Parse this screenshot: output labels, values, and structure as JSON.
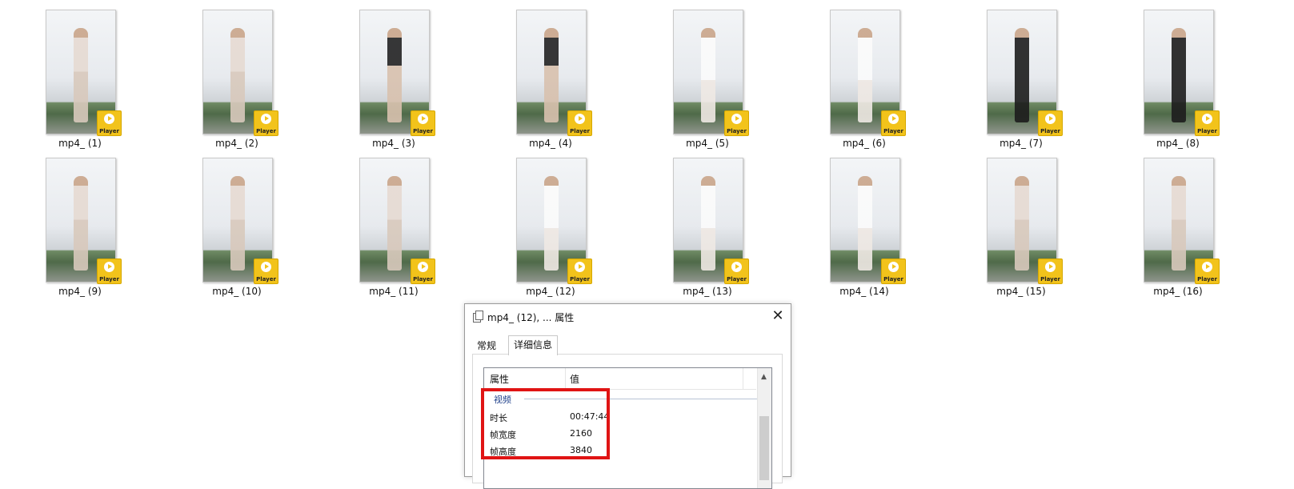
{
  "files": [
    {
      "name": "mp4_ (1)",
      "style": "light"
    },
    {
      "name": "mp4_ (2)",
      "style": "light"
    },
    {
      "name": "mp4_ (3)",
      "style": "mid"
    },
    {
      "name": "mp4_ (4)",
      "style": "mid"
    },
    {
      "name": "mp4_ (5)",
      "style": "white"
    },
    {
      "name": "mp4_ (6)",
      "style": "white"
    },
    {
      "name": "mp4_ (7)",
      "style": "dark"
    },
    {
      "name": "mp4_ (8)",
      "style": "dark"
    },
    {
      "name": "mp4_ (9)",
      "style": "light"
    },
    {
      "name": "mp4_ (10)",
      "style": "light"
    },
    {
      "name": "mp4_ (11)",
      "style": "light"
    },
    {
      "name": "mp4_ (12)",
      "style": "white"
    },
    {
      "name": "mp4_ (13)",
      "style": "white"
    },
    {
      "name": "mp4_ (14)",
      "style": "white"
    },
    {
      "name": "mp4_ (15)",
      "style": "light"
    },
    {
      "name": "mp4_ (16)",
      "style": "light"
    }
  ],
  "badge_label": "Player",
  "badge_color": "#f2c31b",
  "dialog": {
    "title": "mp4_ (12), ... 属性",
    "close_glyph": "✕",
    "tabs": [
      {
        "label": "常规",
        "active": false
      },
      {
        "label": "详细信息",
        "active": true
      }
    ],
    "columns": {
      "property": "属性",
      "value": "值"
    },
    "section": "视频",
    "rows": [
      {
        "label": "时长",
        "value": "00:47:44"
      },
      {
        "label": "帧宽度",
        "value": "2160"
      },
      {
        "label": "帧高度",
        "value": "3840"
      }
    ]
  },
  "highlight_color": "#e01414"
}
